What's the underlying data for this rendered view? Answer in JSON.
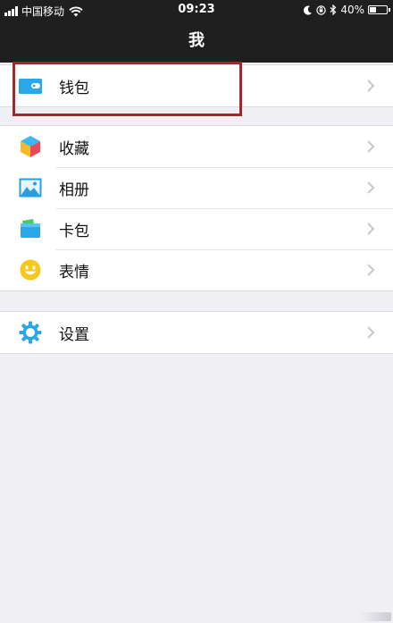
{
  "status_bar": {
    "carrier": "中国移动",
    "time": "09:23",
    "battery": "40%",
    "battery_level": 0.4
  },
  "nav": {
    "title": "我"
  },
  "groups": [
    {
      "items": [
        {
          "label": "钱包",
          "icon": "wallet-icon"
        }
      ]
    },
    {
      "items": [
        {
          "label": "收藏",
          "icon": "favorites-cube-icon"
        },
        {
          "label": "相册",
          "icon": "album-picture-icon"
        },
        {
          "label": "卡包",
          "icon": "card-pack-icon"
        },
        {
          "label": "表情",
          "icon": "smiley-face-icon"
        }
      ]
    },
    {
      "items": [
        {
          "label": "设置",
          "icon": "settings-gear-icon"
        }
      ]
    }
  ],
  "colors": {
    "nav_bg": "#1f1f1f",
    "page_bg": "#efeff4",
    "highlight_border": "#a3262a",
    "icon_blue": "#2aa7e8",
    "icon_yellow": "#f6c81c"
  }
}
